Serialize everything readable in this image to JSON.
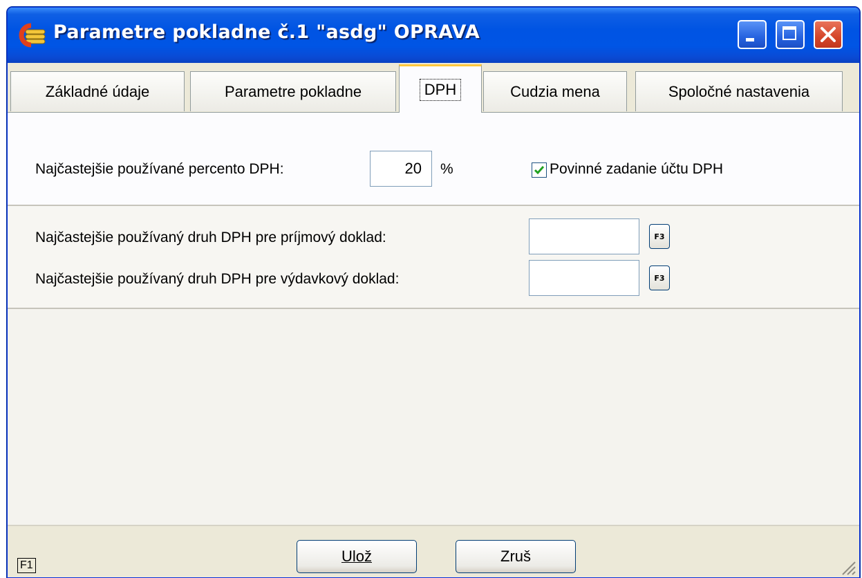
{
  "window": {
    "title": "Parametre pokladne č.1 \"asdg\" OPRAVA"
  },
  "tabs": [
    {
      "label": "Základné údaje",
      "active": false
    },
    {
      "label": "Parametre pokladne",
      "active": false
    },
    {
      "label": "DPH",
      "active": true
    },
    {
      "label": "Cudzia mena",
      "active": false
    },
    {
      "label": "Spoločné nastavenia",
      "active": false
    }
  ],
  "dph": {
    "percent_label": "Najčastejšie používané percento DPH:",
    "percent_value": "20",
    "percent_unit": "%",
    "mandatory_account_label": "Povinné zadanie účtu DPH",
    "mandatory_account_checked": true,
    "income_type_label": "Najčastejšie používaný druh DPH pre príjmový doklad:",
    "income_type_value": "",
    "expense_type_label": "Najčastejšie používaný druh DPH pre výdavkový doklad:",
    "expense_type_value": "",
    "lookup_button_label": "F3"
  },
  "footer": {
    "help_key": "F1",
    "save_label": "Ulož",
    "cancel_label": "Zruš"
  },
  "colors": {
    "titlebar": "#0054e3",
    "active_tab_accent": "#ffc83c",
    "checkmark": "#21a121"
  }
}
